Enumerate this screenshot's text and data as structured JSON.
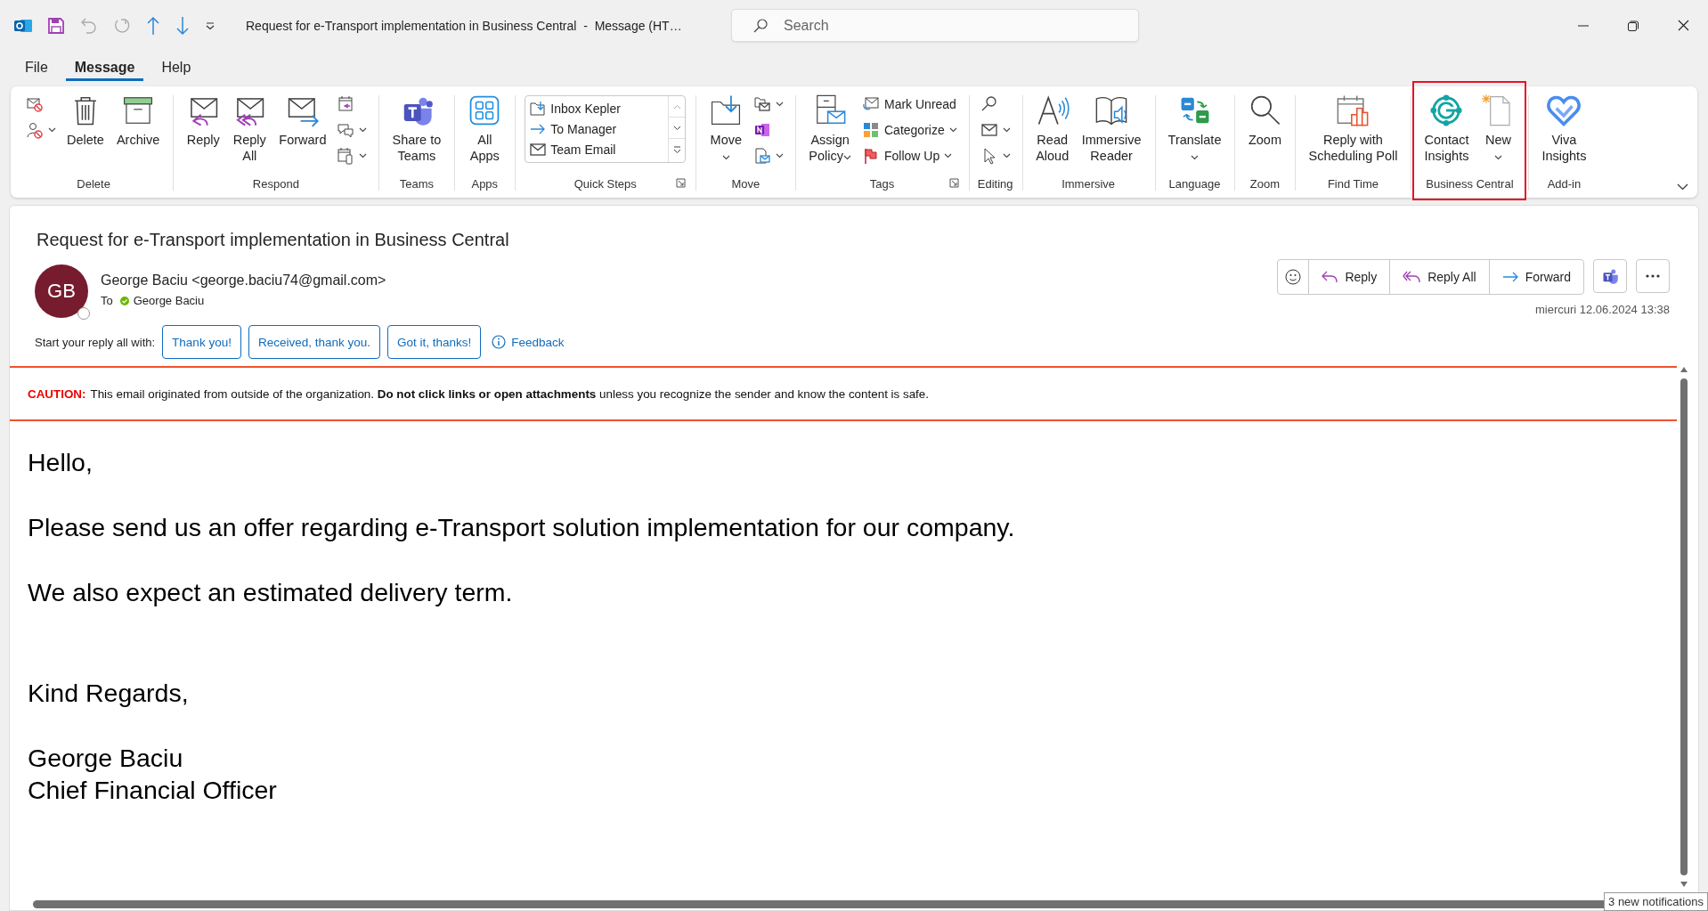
{
  "title_bar": {
    "title": "Request for e-Transport implementation in Business Central  -  Message (HT…",
    "search_placeholder": "Search"
  },
  "menu_tabs": [
    {
      "label": "File",
      "selected": false
    },
    {
      "label": "Message",
      "selected": true
    },
    {
      "label": "Help",
      "selected": false
    }
  ],
  "ribbon": {
    "groups": [
      {
        "label": "Delete",
        "launcher": false,
        "highlighted": false,
        "columns": [
          {
            "kind": "stack",
            "items": [
              {
                "dropdown": false
              },
              {
                "dropdown": true
              }
            ]
          },
          {
            "kind": "large",
            "lines": [
              "Delete"
            ],
            "dropdown": false
          },
          {
            "kind": "large",
            "lines": [
              "Archive"
            ],
            "dropdown": false
          }
        ]
      },
      {
        "label": "Respond",
        "launcher": false,
        "highlighted": false,
        "columns": [
          {
            "kind": "large",
            "lines": [
              "Reply"
            ],
            "dropdown": false
          },
          {
            "kind": "large",
            "lines": [
              "Reply",
              "All"
            ],
            "dropdown": false
          },
          {
            "kind": "large",
            "lines": [
              "Forward"
            ],
            "dropdown": false
          },
          {
            "kind": "stack",
            "items": [
              {
                "dropdown": false
              },
              {
                "dropdown": true
              },
              {
                "dropdown": true
              }
            ]
          }
        ]
      },
      {
        "label": "Teams",
        "launcher": false,
        "highlighted": false,
        "columns": [
          {
            "kind": "large",
            "lines": [
              "Share to",
              "Teams"
            ],
            "dropdown": false
          }
        ]
      },
      {
        "label": "Apps",
        "launcher": false,
        "highlighted": false,
        "columns": [
          {
            "kind": "large",
            "lines": [
              "All",
              "Apps"
            ],
            "dropdown": false
          }
        ]
      },
      {
        "label": "Quick Steps",
        "launcher": true,
        "highlighted": false,
        "columns": [
          {
            "kind": "gallery",
            "items": [
              {
                "label": "Inbox Kepler"
              },
              {
                "label": "To Manager"
              },
              {
                "label": "Team Email"
              }
            ]
          }
        ]
      },
      {
        "label": "Move",
        "launcher": false,
        "highlighted": false,
        "columns": [
          {
            "kind": "large",
            "lines": [
              "Move"
            ],
            "dropdown": true
          },
          {
            "kind": "stack",
            "items": [
              {
                "dropdown": true
              },
              {
                "dropdown": false
              },
              {
                "dropdown": true
              }
            ]
          }
        ]
      },
      {
        "label": "Tags",
        "launcher": true,
        "highlighted": false,
        "columns": [
          {
            "kind": "large",
            "lines": [
              "Assign",
              "Policy"
            ],
            "dropdown": true
          },
          {
            "kind": "stack",
            "items": [
              {
                "label": "Mark Unread",
                "dropdown": false
              },
              {
                "label": "Categorize",
                "dropdown": true
              },
              {
                "label": "Follow Up",
                "dropdown": true
              }
            ]
          }
        ]
      },
      {
        "label": "Editing",
        "launcher": false,
        "highlighted": false,
        "columns": [
          {
            "kind": "stack",
            "items": [
              {
                "dropdown": false
              },
              {
                "dropdown": true
              },
              {
                "dropdown": true
              }
            ]
          }
        ]
      },
      {
        "label": "Immersive",
        "launcher": false,
        "highlighted": false,
        "columns": [
          {
            "kind": "large",
            "lines": [
              "Read",
              "Aloud"
            ],
            "dropdown": false
          },
          {
            "kind": "large",
            "lines": [
              "Immersive",
              "Reader"
            ],
            "dropdown": false
          }
        ]
      },
      {
        "label": "Language",
        "launcher": false,
        "highlighted": false,
        "columns": [
          {
            "kind": "large",
            "lines": [
              "Translate"
            ],
            "dropdown": true
          }
        ]
      },
      {
        "label": "Zoom",
        "launcher": false,
        "highlighted": false,
        "columns": [
          {
            "kind": "large",
            "lines": [
              "Zoom"
            ],
            "dropdown": false
          }
        ]
      },
      {
        "label": "Find Time",
        "launcher": false,
        "highlighted": false,
        "columns": [
          {
            "kind": "large",
            "lines": [
              "Reply with",
              "Scheduling Poll"
            ],
            "dropdown": false
          }
        ]
      },
      {
        "label": "Business Central",
        "launcher": false,
        "highlighted": true,
        "columns": [
          {
            "kind": "large",
            "lines": [
              "Contact",
              "Insights"
            ],
            "dropdown": false
          },
          {
            "kind": "large",
            "lines": [
              "New"
            ],
            "dropdown": true
          }
        ]
      },
      {
        "label": "Add-in",
        "launcher": false,
        "highlighted": false,
        "columns": [
          {
            "kind": "large",
            "lines": [
              "Viva",
              "Insights"
            ],
            "dropdown": false
          }
        ]
      }
    ]
  },
  "message": {
    "subject": "Request for e-Transport implementation in Business Central",
    "sender": {
      "initials": "GB",
      "name_line": "George Baciu <george.baciu74@gmail.com>"
    },
    "to_label": "To",
    "recipients": [
      {
        "name": "George Baciu"
      }
    ],
    "actions": [
      {
        "label": "Reply"
      },
      {
        "label": "Reply All"
      },
      {
        "label": "Forward"
      }
    ],
    "date": "miercuri 12.06.2024 13:38",
    "suggested_replies": {
      "prompt": "Start your reply all with:",
      "options": [
        "Thank you!",
        "Received, thank you.",
        "Got it, thanks!"
      ],
      "feedback": "Feedback"
    },
    "caution": {
      "label": "CAUTION:",
      "text": "This email originated from outside of the organization. **Do not click links or open attachments** unless you recognize the sender and know the content is safe."
    },
    "body": {
      "paragraphs": [
        {
          "lines": [
            "Hello,"
          ]
        },
        {
          "lines": [
            "Please send us an offer regarding e-Transport solution implementation for our company."
          ]
        },
        {
          "lines": [
            "We also expect an estimated delivery term."
          ]
        }
      ],
      "closing": [
        {
          "lines": [
            "Kind Regards,"
          ]
        },
        {
          "lines": [
            "George Baciu",
            "Chief Financial Officer"
          ]
        }
      ]
    }
  },
  "notification": "3 new notifications"
}
